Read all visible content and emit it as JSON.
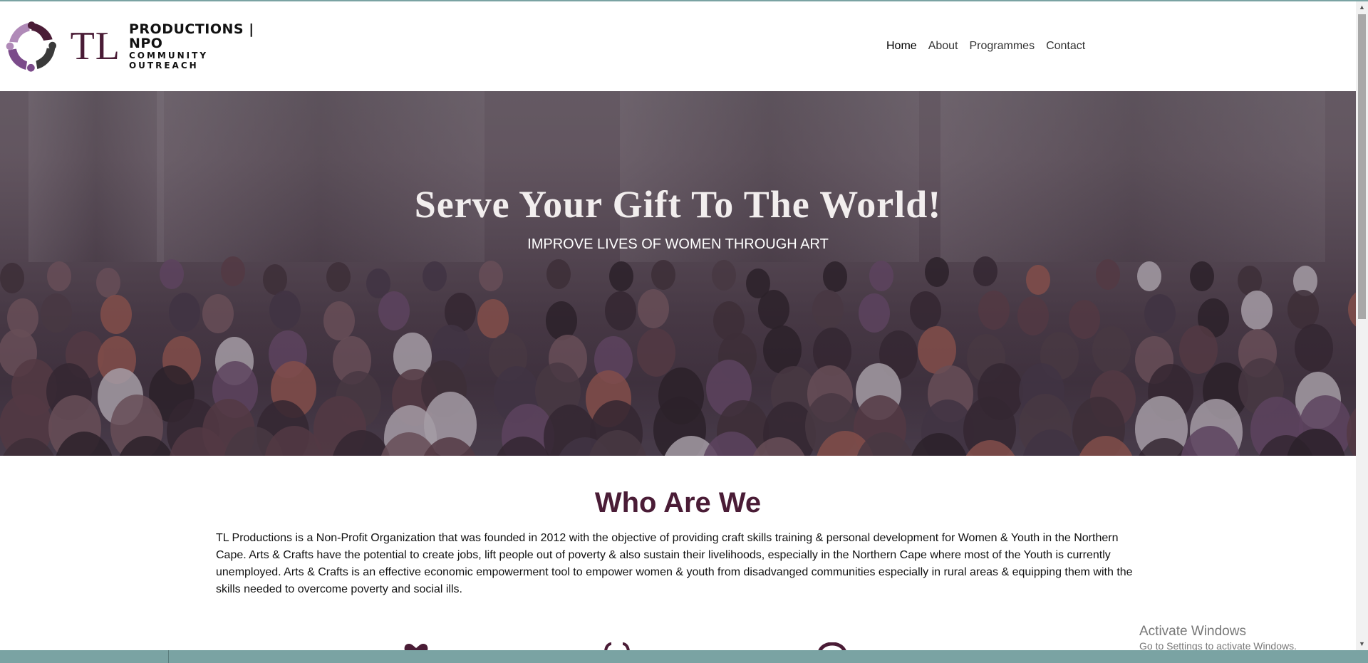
{
  "brand": {
    "logo_initials": "TL",
    "name_line1": "PRODUCTIONS | NPO",
    "name_line2": "COMMUNITY OUTREACH",
    "color_primary": "#4a1c36",
    "color_secondary": "#7b4b8a"
  },
  "nav": {
    "items": [
      {
        "label": "Home",
        "active": true
      },
      {
        "label": "About",
        "active": false
      },
      {
        "label": "Programmes",
        "active": false
      },
      {
        "label": "Contact",
        "active": false
      }
    ]
  },
  "hero": {
    "title": "Serve Your Gift To The World!",
    "subtitle": "IMPROVE LIVES OF WOMEN THROUGH ART",
    "background": "crowd-photo"
  },
  "about": {
    "title": "Who Are We",
    "body": "TL Productions is a Non-Profit Organization that was founded in 2012 with the objective of providing craft skills training & personal development for Women & Youth in the Northern Cape. Arts & Crafts have the potential to create jobs, lift people out of poverty & also sustain their livelihoods, especially in the Northern Cape where most of the Youth is currently unemployed. Arts & Crafts is an effective economic empowerment tool to empower women & youth from disadvanged communities especially in rural areas & equipping them with the skills needed to overcome poverty and social ills."
  },
  "feature_icons": [
    "heart-icon",
    "hands-icon",
    "circle-icon"
  ],
  "watermark": {
    "title": "Activate Windows",
    "subtitle": "Go to Settings to activate Windows."
  }
}
